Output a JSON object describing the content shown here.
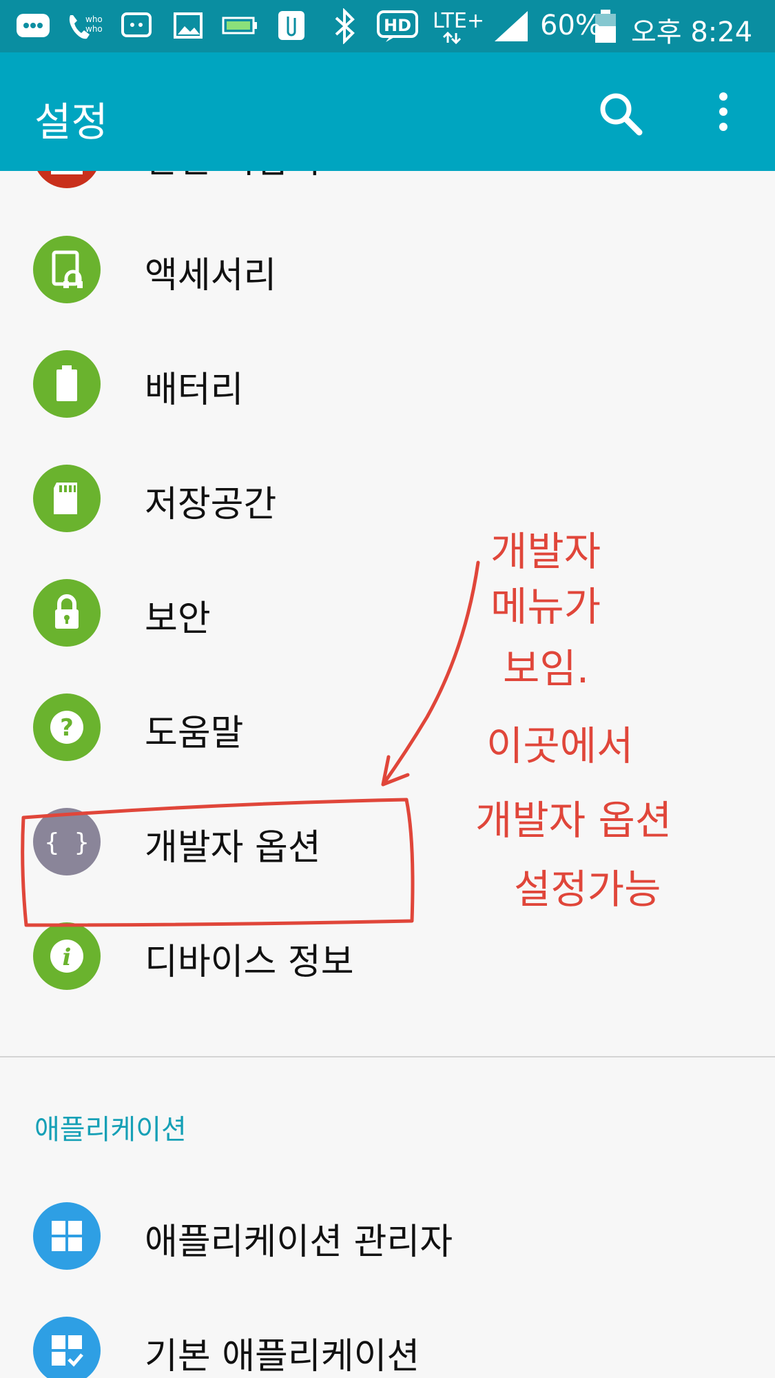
{
  "status_bar": {
    "battery": "60%",
    "time": "오후 8:24",
    "network": "LTE+",
    "hd": "HD",
    "icons": [
      "message-icon",
      "whowho-icon",
      "chat-icon",
      "gallery-icon",
      "battery-saver-icon",
      "clip-icon",
      "bluetooth-icon",
      "hd-voice-icon",
      "lte-icon",
      "signal-icon",
      "battery-icon"
    ]
  },
  "app_bar": {
    "title": "설정",
    "search_icon": "search-icon",
    "more_icon": "more-vert-icon"
  },
  "items": [
    {
      "label": "안전 지킴이",
      "icon": "warning-icon",
      "color": "#c9301c"
    },
    {
      "label": "액세서리",
      "icon": "accessory-icon",
      "color": "#6ab32e"
    },
    {
      "label": "배터리",
      "icon": "battery-icon",
      "color": "#6ab32e"
    },
    {
      "label": "저장공간",
      "icon": "sd-card-icon",
      "color": "#6ab32e"
    },
    {
      "label": "보안",
      "icon": "lock-icon",
      "color": "#6ab32e"
    },
    {
      "label": "도움말",
      "icon": "help-icon",
      "color": "#6ab32e"
    },
    {
      "label": "개발자 옵션",
      "icon": "developer-braces-icon",
      "color": "#8a8599"
    },
    {
      "label": "디바이스 정보",
      "icon": "info-icon",
      "color": "#6ab32e"
    }
  ],
  "section_header": "애플리케이션",
  "app_items": [
    {
      "label": "애플리케이션 관리자",
      "icon": "app-grid-icon",
      "color": "#2e9fe4"
    },
    {
      "label": "기본 애플리케이션",
      "icon": "default-apps-icon",
      "color": "#2e9fe4"
    }
  ],
  "annotation": {
    "lines": [
      "개발자",
      "메뉴가",
      "보임.",
      "이곳에서",
      "개발자 옵션",
      "설정가능"
    ],
    "color": "#e0463a"
  }
}
